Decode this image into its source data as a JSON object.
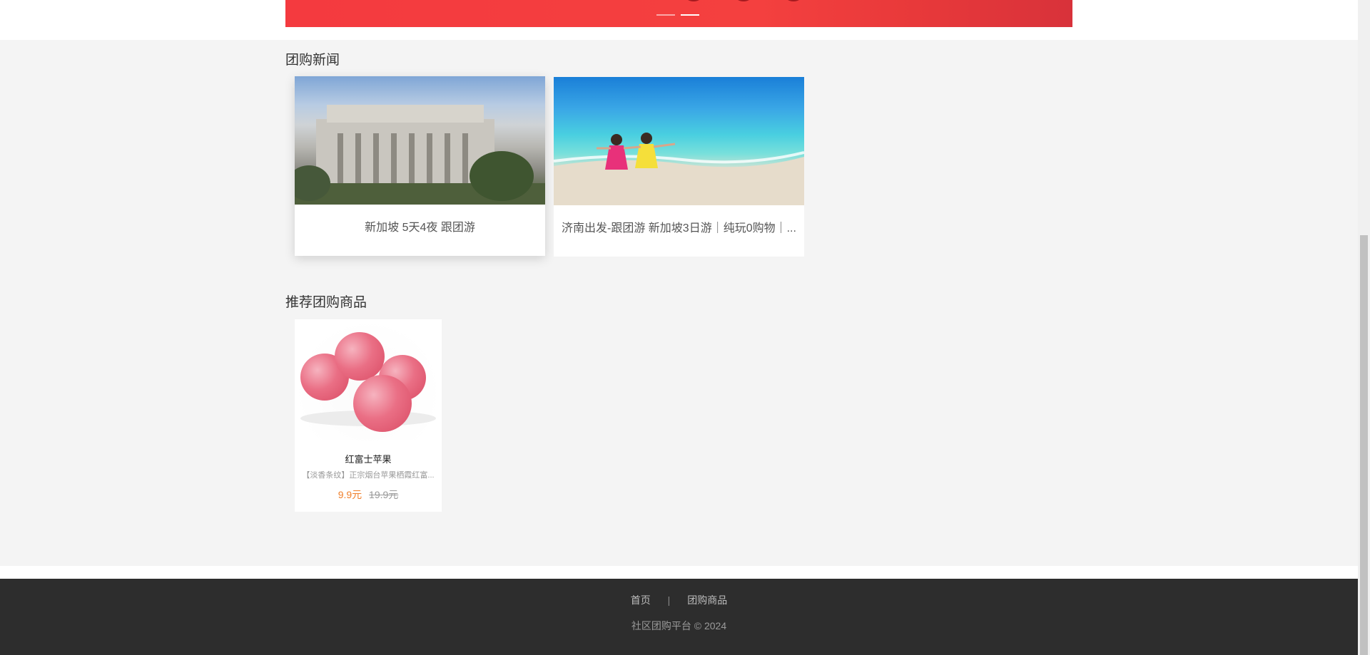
{
  "banner": {
    "slides": 2,
    "active_slide": 2
  },
  "news_section": {
    "title": "团购新闻",
    "items": [
      {
        "title": "新加坡 5天4夜 跟团游"
      },
      {
        "title": "济南出发-跟团游 新加坡3日游｜纯玩0购物｜..."
      }
    ]
  },
  "products_section": {
    "title": "推荐团购商品",
    "items": [
      {
        "name": "红富士苹果",
        "desc": "【淡香条纹】正宗烟台苹果栖霞红富...",
        "price": "9.9元",
        "original_price": "19.9元"
      }
    ]
  },
  "footer": {
    "nav": [
      "首页",
      "团购商品"
    ],
    "separator": "|",
    "copyright": "社区团购平台 © 2024"
  },
  "colors": {
    "banner_red": "#f43a3f",
    "price_orange": "#f07f2a",
    "footer_bg": "#2d2d2d",
    "main_bg": "#f4f4f4"
  }
}
